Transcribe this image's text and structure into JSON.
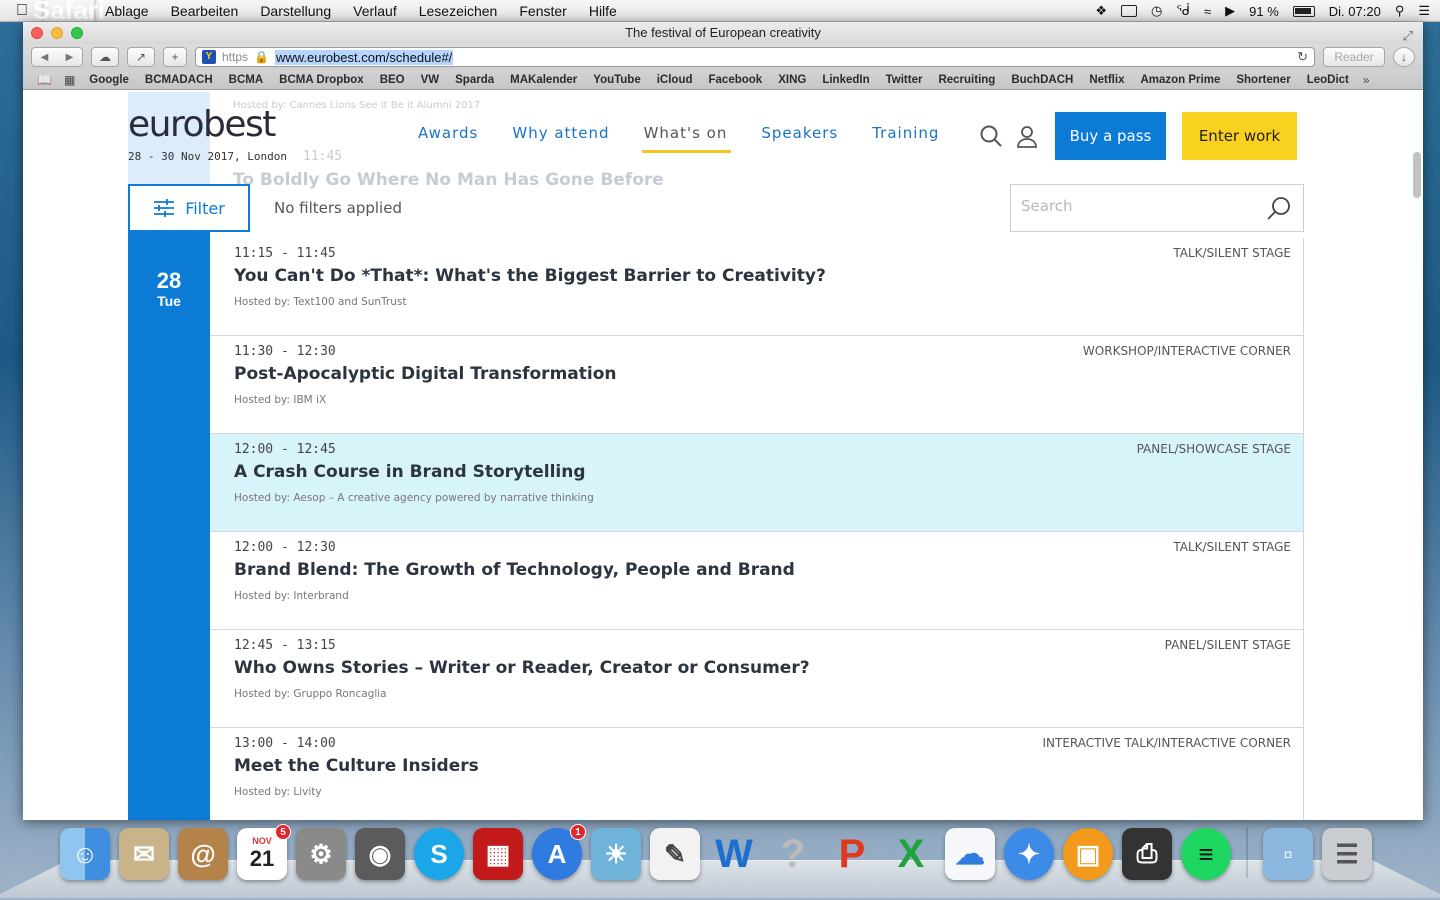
{
  "menubar": {
    "app_name": "Safari",
    "items": [
      "Ablage",
      "Bearbeiten",
      "Darstellung",
      "Verlauf",
      "Lesezeichen",
      "Fenster",
      "Hilfe"
    ],
    "battery": "91 %",
    "clock": "Di. 07:20"
  },
  "browser": {
    "window_title": "The festival of European creativity",
    "url_scheme": "https",
    "url": "www.eurobest.com/schedule#/",
    "reader_label": "Reader",
    "bookmarks": [
      "Google",
      "BCMADACH",
      "BCMA",
      "BCMA Dropbox",
      "BEO",
      "VW",
      "Sparda",
      "MAKalender",
      "YouTube",
      "iCloud",
      "Facebook",
      "XING",
      "LinkedIn",
      "Twitter",
      "Recruiting",
      "BuchDACH",
      "Netflix",
      "Amazon Prime",
      "Shortener",
      "LeoDict"
    ]
  },
  "site": {
    "logo": "eurobest",
    "logo_sub": "28 - 30 Nov 2017, London",
    "nav": [
      "Awards",
      "Why attend",
      "What's on",
      "Speakers",
      "Training"
    ],
    "active_nav_index": 2,
    "buy_label": "Buy a pass",
    "enter_label": "Enter work",
    "filter_label": "Filter",
    "filter_status": "No filters applied",
    "search_placeholder": "Search"
  },
  "schedule": {
    "date_day": "28",
    "date_weekday": "Tue",
    "faded_host": "Hosted by: Cannes Lions See it Be it Alumni 2017",
    "faded_time": "11:45",
    "faded_title": "To Boldly Go Where No Man Has Gone Before",
    "sessions": [
      {
        "time": "11:15 - 11:45",
        "category": "TALK/SILENT STAGE",
        "title": "You Can't Do *That*: What's the Biggest Barrier to Creativity?",
        "host": "Hosted by: Text100 and SunTrust"
      },
      {
        "time": "11:30 - 12:30",
        "category": "WORKSHOP/INTERACTIVE CORNER",
        "title": "Post-Apocalyptic Digital Transformation",
        "host": "Hosted by: IBM iX"
      },
      {
        "time": "12:00 - 12:45",
        "category": "PANEL/SHOWCASE STAGE",
        "title": "A Crash Course in Brand Storytelling",
        "host": "Hosted by: Aesop – A creative agency powered by narrative thinking"
      },
      {
        "time": "12:00 - 12:30",
        "category": "TALK/SILENT STAGE",
        "title": "Brand Blend: The Growth of Technology, People and Brand",
        "host": "Hosted by: Interbrand"
      },
      {
        "time": "12:45 - 13:15",
        "category": "PANEL/SILENT STAGE",
        "title": "Who Owns Stories – Writer or Reader, Creator or Consumer?",
        "host": "Hosted by: Gruppo Roncaglia"
      },
      {
        "time": "13:00 - 14:00",
        "category": "INTERACTIVE TALK/INTERACTIVE CORNER",
        "title": "Meet the Culture Insiders",
        "host": "Hosted by: Livity"
      }
    ]
  },
  "dock": {
    "calendar_day": "21",
    "calendar_month": "NOV",
    "calendar_badge": "5",
    "appstore_badge": "1"
  },
  "colors": {
    "brand_blue": "#0c7bd6",
    "brand_yellow": "#f8d21f",
    "highlight_row": "#d8f4fb"
  }
}
